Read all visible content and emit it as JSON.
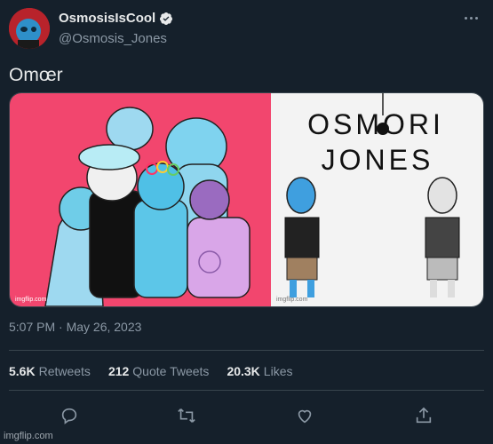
{
  "tweet": {
    "display_name": "OsmosisIsCool",
    "handle": "@Osmosis_Jones",
    "text": "Omœr",
    "timestamp": "5:07 PM · May 26, 2023",
    "verified_icon": "verified-badge-icon"
  },
  "media": {
    "left_panel_bg": "#f2466e",
    "right_panel_title_line1": "OSMORI",
    "right_panel_title_line2": "JONES",
    "left_watermark": "imgflip.com",
    "right_watermark": "imgflip.com"
  },
  "stats": [
    {
      "count": "5.6K",
      "label": "Retweets"
    },
    {
      "count": "212",
      "label": "Quote Tweets"
    },
    {
      "count": "20.3K",
      "label": "Likes"
    }
  ],
  "actions": [
    "reply-icon",
    "retweet-icon",
    "like-icon",
    "share-icon"
  ],
  "watermark": "imgflip.com",
  "colors": {
    "background": "#15202b",
    "text": "#e7e9ea",
    "muted": "#8b98a5",
    "verified": "#1d9bf0",
    "border": "#38444d"
  }
}
